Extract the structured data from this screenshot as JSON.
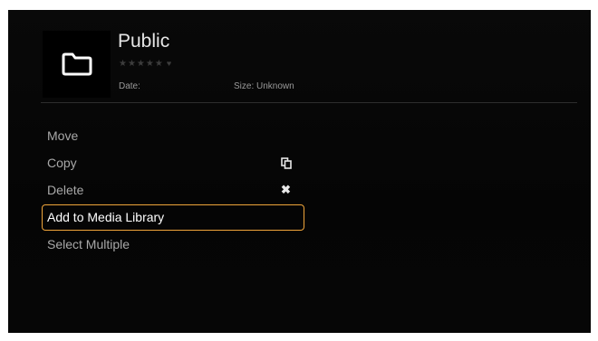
{
  "header": {
    "title": "Public",
    "stars": "★★★★★",
    "heart": "♥",
    "date_label": "Date:",
    "size_label": "Size: Unknown"
  },
  "menu": {
    "items": [
      {
        "label": "Move"
      },
      {
        "label": "Copy",
        "icon": "copy-icon"
      },
      {
        "label": "Delete",
        "icon": "close-icon",
        "glyph": "✖"
      },
      {
        "label": "Add to Media Library",
        "selected": true
      },
      {
        "label": "Select Multiple"
      }
    ]
  },
  "colors": {
    "background": "#070707",
    "highlight_border": "#f0a53a",
    "text_primary": "#ffffff",
    "text_secondary": "#a8a8a8"
  }
}
